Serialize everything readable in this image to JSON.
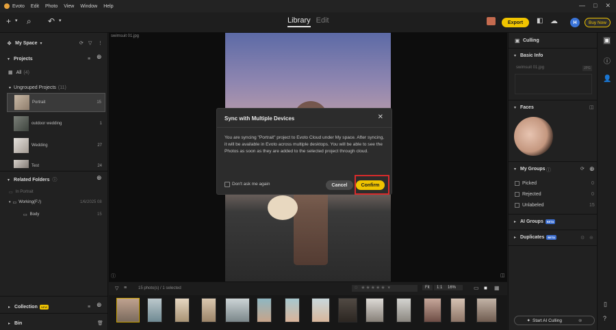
{
  "menubar": {
    "app": "Evoto",
    "items": [
      "Edit",
      "Photo",
      "View",
      "Window",
      "Help"
    ]
  },
  "toolbar": {
    "tab_library": "Library",
    "tab_edit": "Edit",
    "export_label": "Export",
    "buynow_label": "Buy Now",
    "avatar_letter": "H"
  },
  "left": {
    "space_label": "My Space",
    "projects_label": "Projects",
    "all_label": "All",
    "all_count": "(4)",
    "ungrouped_label": "Ungrouped Projects",
    "ungrouped_count": "(11)",
    "projects": [
      {
        "name": "Portrait",
        "count": "15"
      },
      {
        "name": "outdoor wedding",
        "count": "1"
      },
      {
        "name": "Wedding",
        "count": "27"
      },
      {
        "name": "Test",
        "count": "24"
      }
    ],
    "related_folders_label": "Related Folders",
    "folder_root": "In Portrait",
    "folder_working": "Working(F:/)",
    "folder_working_date": "1/6/2025 08",
    "folder_body": "Body",
    "folder_body_count": "15",
    "collection_label": "Collection",
    "collection_badge": "NEW",
    "bin_label": "Bin"
  },
  "center": {
    "filename": "swimsuit 01.jpg"
  },
  "modal": {
    "title": "Sync with Multiple Devices",
    "body": "You are syncing \"Portrait\" project to Evoto Cloud under My space. After syncing, it will be available in Evoto across multiple desktops. You will be able to see the Photos as soon as they are added to the selected project through cloud.",
    "dont_ask": "Don't ask me again",
    "cancel": "Cancel",
    "confirm": "Confirm"
  },
  "filmbar": {
    "count_text": "15 photo(s) / 1 selected",
    "fit": "Fit",
    "ratio": "1:1",
    "zoom": "16%"
  },
  "right": {
    "culling_label": "Culling",
    "basic_info_label": "Basic Info",
    "file_name": "swimsuit 01.jpg",
    "file_ext": "JPG",
    "faces_label": "Faces",
    "my_groups_label": "My Groups",
    "groups": [
      {
        "name": "Picked",
        "count": "0"
      },
      {
        "name": "Rejected",
        "count": "0"
      },
      {
        "name": "Unlabeled",
        "count": "15"
      }
    ],
    "ai_groups_label": "AI Groups",
    "duplicates_label": "Duplicates",
    "ai_badge": "BETA",
    "ai_culling_label": "Start AI Culling"
  },
  "colors": {
    "accent": "#f0c400",
    "highlight": "#d92b2b",
    "avatar": "#3a74d8"
  }
}
